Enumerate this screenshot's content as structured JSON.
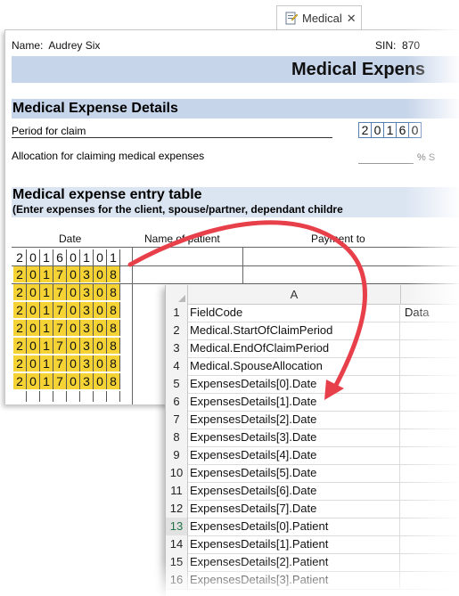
{
  "tab": {
    "label": "Medical",
    "close": "✕"
  },
  "form": {
    "name_label": "Name:",
    "name_value": "Audrey Six",
    "sin_label": "SIN:",
    "sin_value": "870",
    "title": "Medical Expens",
    "section_title": "Medical Expense Details",
    "period_label": "Period for claim",
    "period_digits": [
      "2",
      "0",
      "1",
      "6",
      "0"
    ],
    "allocation_label": "Allocation for claiming medical expenses",
    "allocation_suffix": "% S",
    "entry_title": "Medical expense entry table",
    "entry_subtitle": "(Enter expenses for the client, spouse/partner, dependant childre",
    "col_date": "Date",
    "col_patient": "Name of patient",
    "col_payment": "Payment to",
    "first_date": [
      "2",
      "0",
      "1",
      "6",
      "0",
      "1",
      "0",
      "1"
    ],
    "filled_date": [
      "2",
      "0",
      "1",
      "7",
      "0",
      "3",
      "0",
      "8"
    ],
    "highlight_color": "#f5d335"
  },
  "sheet": {
    "col_a": "A",
    "rows": [
      {
        "n": "1",
        "a": "FieldCode",
        "b": "Data"
      },
      {
        "n": "2",
        "a": "Medical.StartOfClaimPeriod",
        "b": ""
      },
      {
        "n": "3",
        "a": "Medical.EndOfClaimPeriod",
        "b": ""
      },
      {
        "n": "4",
        "a": "Medical.SpouseAllocation",
        "b": ""
      },
      {
        "n": "5",
        "a": "ExpensesDetails[0].Date",
        "b": ""
      },
      {
        "n": "6",
        "a": "ExpensesDetails[1].Date",
        "b": ""
      },
      {
        "n": "7",
        "a": "ExpensesDetails[2].Date",
        "b": ""
      },
      {
        "n": "8",
        "a": "ExpensesDetails[3].Date",
        "b": ""
      },
      {
        "n": "9",
        "a": "ExpensesDetails[4].Date",
        "b": ""
      },
      {
        "n": "10",
        "a": "ExpensesDetails[5].Date",
        "b": ""
      },
      {
        "n": "11",
        "a": "ExpensesDetails[6].Date",
        "b": ""
      },
      {
        "n": "12",
        "a": "ExpensesDetails[7].Date",
        "b": ""
      },
      {
        "n": "13",
        "a": "ExpensesDetails[0].Patient",
        "b": ""
      },
      {
        "n": "14",
        "a": "ExpensesDetails[1].Patient",
        "b": ""
      },
      {
        "n": "15",
        "a": "ExpensesDetails[2].Patient",
        "b": ""
      },
      {
        "n": "16",
        "a": "ExpensesDetails[3].Patient",
        "b": ""
      }
    ],
    "selected_row": "13"
  },
  "arrow_color": "#e8404a"
}
